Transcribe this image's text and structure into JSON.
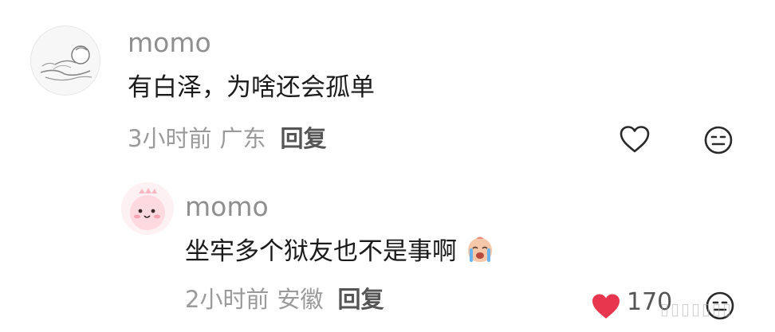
{
  "comments": [
    {
      "username": "momo",
      "text": "有白泽，为啥还会孤单",
      "time": "3小时前",
      "location": "广东",
      "reply_label": "回复",
      "liked": false,
      "avatar_icon": "sketch-figure-icon"
    },
    {
      "username": "momo",
      "text": "坐牢多个狱友也不是事啊",
      "emoji_icon": "crying-face-emoji-icon",
      "time": "2小时前",
      "location": "安徽",
      "reply_label": "回复",
      "liked": true,
      "like_count": "170",
      "avatar_icon": "pink-dino-avatar-icon"
    }
  ],
  "colors": {
    "like_active": "#e8364f",
    "username": "#8f8f8f",
    "meta": "#9a9a9a"
  }
}
